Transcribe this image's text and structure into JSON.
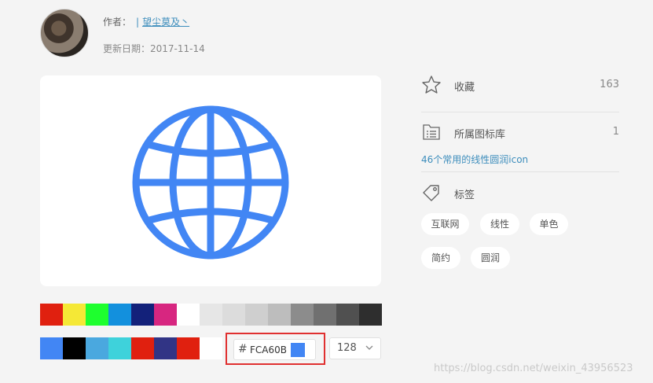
{
  "author": {
    "label": "作者：",
    "separator": "|",
    "name": "望尘莫及丶"
  },
  "update": {
    "label": "更新日期：",
    "date": "2017-11-14"
  },
  "icon": {
    "name": "globe-icon",
    "color": "#4286F4"
  },
  "palette_row1": [
    "#E0200F",
    "#F5E836",
    "#1EFF2E",
    "#1390DD",
    "#13217A",
    "#D72680",
    "#FFFFFF",
    "#E6E6E6",
    "#DCDCDC",
    "#CFCFCF",
    "#BDBDBD",
    "#8C8C8C",
    "#707070",
    "#505050",
    "#2E2E2E"
  ],
  "palette_row2": [
    "#4286F4",
    "#000000",
    "#4AA8DF",
    "#3ED2DB",
    "#E0200F",
    "#313485",
    "#E0200F",
    "#FFFFFF"
  ],
  "color_input": {
    "hash": "#",
    "value": "FCA60B",
    "chip_color": "#4286F4"
  },
  "size_select": {
    "value": "128"
  },
  "sidebar": {
    "favorites": {
      "label": "收藏",
      "count": "163"
    },
    "library": {
      "label": "所属图标库",
      "count": "1",
      "link": "46个常用的线性圆润icon"
    },
    "tags": {
      "label": "标签",
      "items": [
        "互联网",
        "线性",
        "单色",
        "简约",
        "圆润"
      ]
    }
  },
  "watermark": "https://blog.csdn.net/weixin_43956523"
}
